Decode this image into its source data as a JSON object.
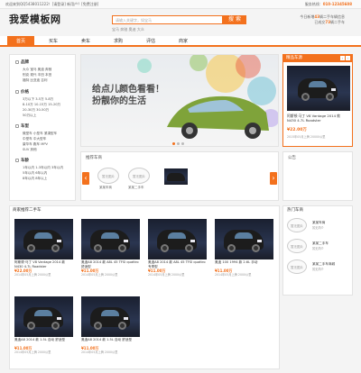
{
  "topbar": {
    "left": "欢迎来到QQ5438011222！[请登录]  新用户？[免费注册]",
    "right_label": "服务热线：",
    "phone": "010-12345608"
  },
  "header": {
    "logo": "我爱模板网",
    "search_placeholder": "请输入关键字，如宝马",
    "search_button": "搜 索",
    "sub_links": "宝马  奔驰  奥迪  大众",
    "stat1_prefix": "今日新增",
    "stat1_num": "43",
    "stat1_suffix": "辆二手车辆信息",
    "stat2_prefix": "已成交",
    "stat2_num": "73",
    "stat2_suffix": "辆二手车"
  },
  "nav": {
    "items": [
      "首页",
      "买车",
      "卖车",
      "求购",
      "评估",
      "商家"
    ],
    "active": 0
  },
  "sidebar": {
    "sections": [
      {
        "title": "品牌",
        "icon": "brand-icon",
        "rows": [
          "大众 宝马 奥迪 奔驰",
          "别克 现代 丰田 本田",
          "福特 比亚迪 吉利"
        ]
      },
      {
        "title": "价格",
        "icon": "price-icon",
        "rows": [
          "3万以下 3-5万 5-8万",
          "8-10万 10-15万 15-20万",
          "20-30万 30-50万",
          "50万以上"
        ]
      },
      {
        "title": "车型",
        "icon": "type-icon",
        "rows": [
          "微型车 小型车 紧凑型车",
          "中型车 中大型车",
          "豪华车 跑车 MPV",
          "SUV 其他"
        ]
      },
      {
        "title": "车龄",
        "icon": "age-icon",
        "rows": [
          "1年以内 1-3年以内 3年以内",
          "5年以内 6年以内",
          "8年以内 8年以上"
        ]
      }
    ]
  },
  "banner": {
    "line1": "给点儿颜色看看！",
    "line2": "扮靓你的生活"
  },
  "hot_car": {
    "title": "精品车源",
    "name": "阿斯顿·马丁 V8 Vantage 2014 款 N430 4.7L Roadster",
    "price": "¥22.00万",
    "date": "2015年05月上牌 20000公里"
  },
  "recommend": {
    "title": "推荐车商",
    "items": [
      "暂无图片",
      "暂无图片",
      "暂无图片"
    ],
    "labels": [
      "某某车商",
      "某某二手车",
      ""
    ]
  },
  "notice": {
    "title": "公告"
  },
  "main": {
    "title": "商家推荐二手车",
    "cars": [
      {
        "name": "阿斯顿·马丁 V8 Vantage 2014 款 N430 4.7L Roadster",
        "price": "¥22.00万",
        "date": "2014年05月上牌 2000公里"
      },
      {
        "name": "奥迪A8 2014 款 A8L 45 TFSI quattro 舒适型",
        "price": "¥11.00万",
        "date": "2014年05月上牌 2000公里"
      },
      {
        "name": "奥迪A8 2014 款 A8L 45 TFSI quattro 专享型",
        "price": "¥11.00万",
        "date": "2014年05月上牌 2000公里"
      },
      {
        "name": "奥迪 100 1994 款 2.6L 手动",
        "price": "¥11.00万",
        "date": "2014年05月上牌 2000公里"
      },
      {
        "name": "奥迪A8 2014 款 1.5L 自动 舒适型",
        "price": "¥11.00万",
        "date": "2014年05月上牌 2000公里"
      },
      {
        "name": "奥迪A8 2014 款 1.5L 自动 舒适型",
        "price": "¥11.00万",
        "date": "2014年05月上牌 2000公里"
      }
    ]
  },
  "hotlist": {
    "title": "热门车商",
    "items": [
      {
        "img": "暂无图片",
        "title": "某某车商",
        "desc": "暂无简介"
      },
      {
        "img": "暂无图片",
        "title": "某某二手车",
        "desc": "暂无简介"
      },
      {
        "img": "暂无图片",
        "title": "某某二手车商城",
        "desc": "暂无简介"
      }
    ]
  }
}
